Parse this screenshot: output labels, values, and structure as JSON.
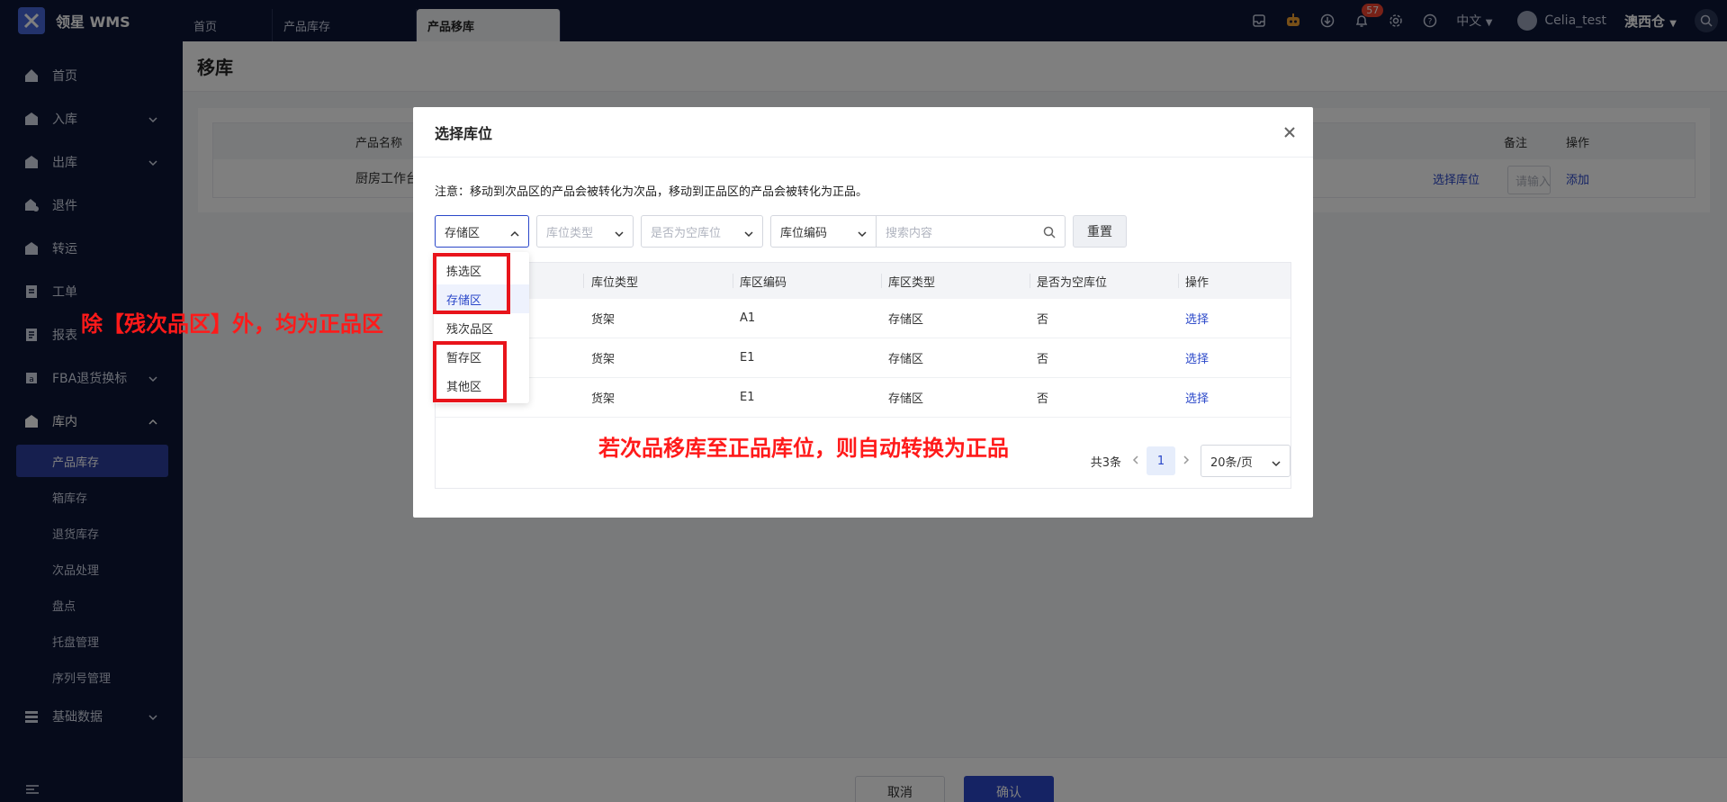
{
  "app": {
    "logo_text": "领星 WMS"
  },
  "tabs": [
    {
      "label": "首页"
    },
    {
      "label": "产品库存"
    },
    {
      "label": "产品移库"
    }
  ],
  "topbar": {
    "notification_count": "57",
    "language": "中文",
    "user": "Celia_test",
    "warehouse": "澳西仓"
  },
  "sidebar": {
    "items": [
      {
        "label": "首页",
        "icon": "home-icon"
      },
      {
        "label": "入库",
        "icon": "inbound-icon"
      },
      {
        "label": "出库",
        "icon": "outbound-icon"
      },
      {
        "label": "退件",
        "icon": "return-icon"
      },
      {
        "label": "转运",
        "icon": "transfer-icon"
      },
      {
        "label": "工单",
        "icon": "workorder-icon"
      },
      {
        "label": "报表",
        "icon": "report-icon"
      },
      {
        "label": "FBA退货换标",
        "icon": "fba-icon"
      },
      {
        "label": "库内",
        "icon": "warehouse-icon"
      }
    ],
    "sub_items": [
      {
        "label": "产品库存"
      },
      {
        "label": "箱库存"
      },
      {
        "label": "退货库存"
      },
      {
        "label": "次品处理"
      },
      {
        "label": "盘点"
      },
      {
        "label": "托盘管理"
      },
      {
        "label": "序列号管理"
      }
    ],
    "basic_data": {
      "label": "基础数据"
    }
  },
  "page": {
    "title": "移库",
    "bg_table": {
      "headers": {
        "product_name": "产品名称",
        "remark": "备注",
        "action": "操作"
      },
      "row": {
        "product_name": "厨房工作台",
        "select_location": "选择库位",
        "remark_placeholder": "请输入",
        "add": "添加"
      }
    },
    "footer": {
      "cancel": "取消",
      "confirm": "确认"
    }
  },
  "modal": {
    "title": "选择库位",
    "notice": "注意：移动到次品区的产品会被转化为次品，移动到正品区的产品会被转化为正品。",
    "filters": {
      "zone_type_value": "存储区",
      "location_type_placeholder": "库位类型",
      "empty_placeholder": "是否为空库位",
      "code_field": "库位编码",
      "search_placeholder": "搜索内容",
      "reset": "重置"
    },
    "table": {
      "headers": [
        "库位类型",
        "库区编码",
        "库区类型",
        "是否为空库位",
        "操作"
      ],
      "rows": [
        {
          "location_type": "货架",
          "zone_code": "A1",
          "zone_type": "存储区",
          "empty": "否",
          "action": "选择"
        },
        {
          "location_type": "货架",
          "zone_code": "E1",
          "zone_type": "存储区",
          "empty": "否",
          "action": "选择"
        },
        {
          "location_type": "货架",
          "zone_code": "E1",
          "zone_type": "存储区",
          "empty": "否",
          "action": "选择"
        }
      ]
    },
    "pagination": {
      "total": "共3条",
      "current": "1",
      "page_size": "20条/页"
    }
  },
  "dropdown": {
    "options": [
      {
        "label": "拣选区"
      },
      {
        "label": "存储区"
      },
      {
        "label": "残次品区"
      },
      {
        "label": "暂存区"
      },
      {
        "label": "其他区"
      }
    ],
    "selected": "存储区"
  },
  "annotations": {
    "left_note": "除【残次品区】外，均为正品区",
    "center_note": "若次品移库至正品库位，则自动转换为正品"
  },
  "colors": {
    "brand": "#2a47c9",
    "nav_bg": "#0c1636",
    "annotation": "#e8141b"
  }
}
